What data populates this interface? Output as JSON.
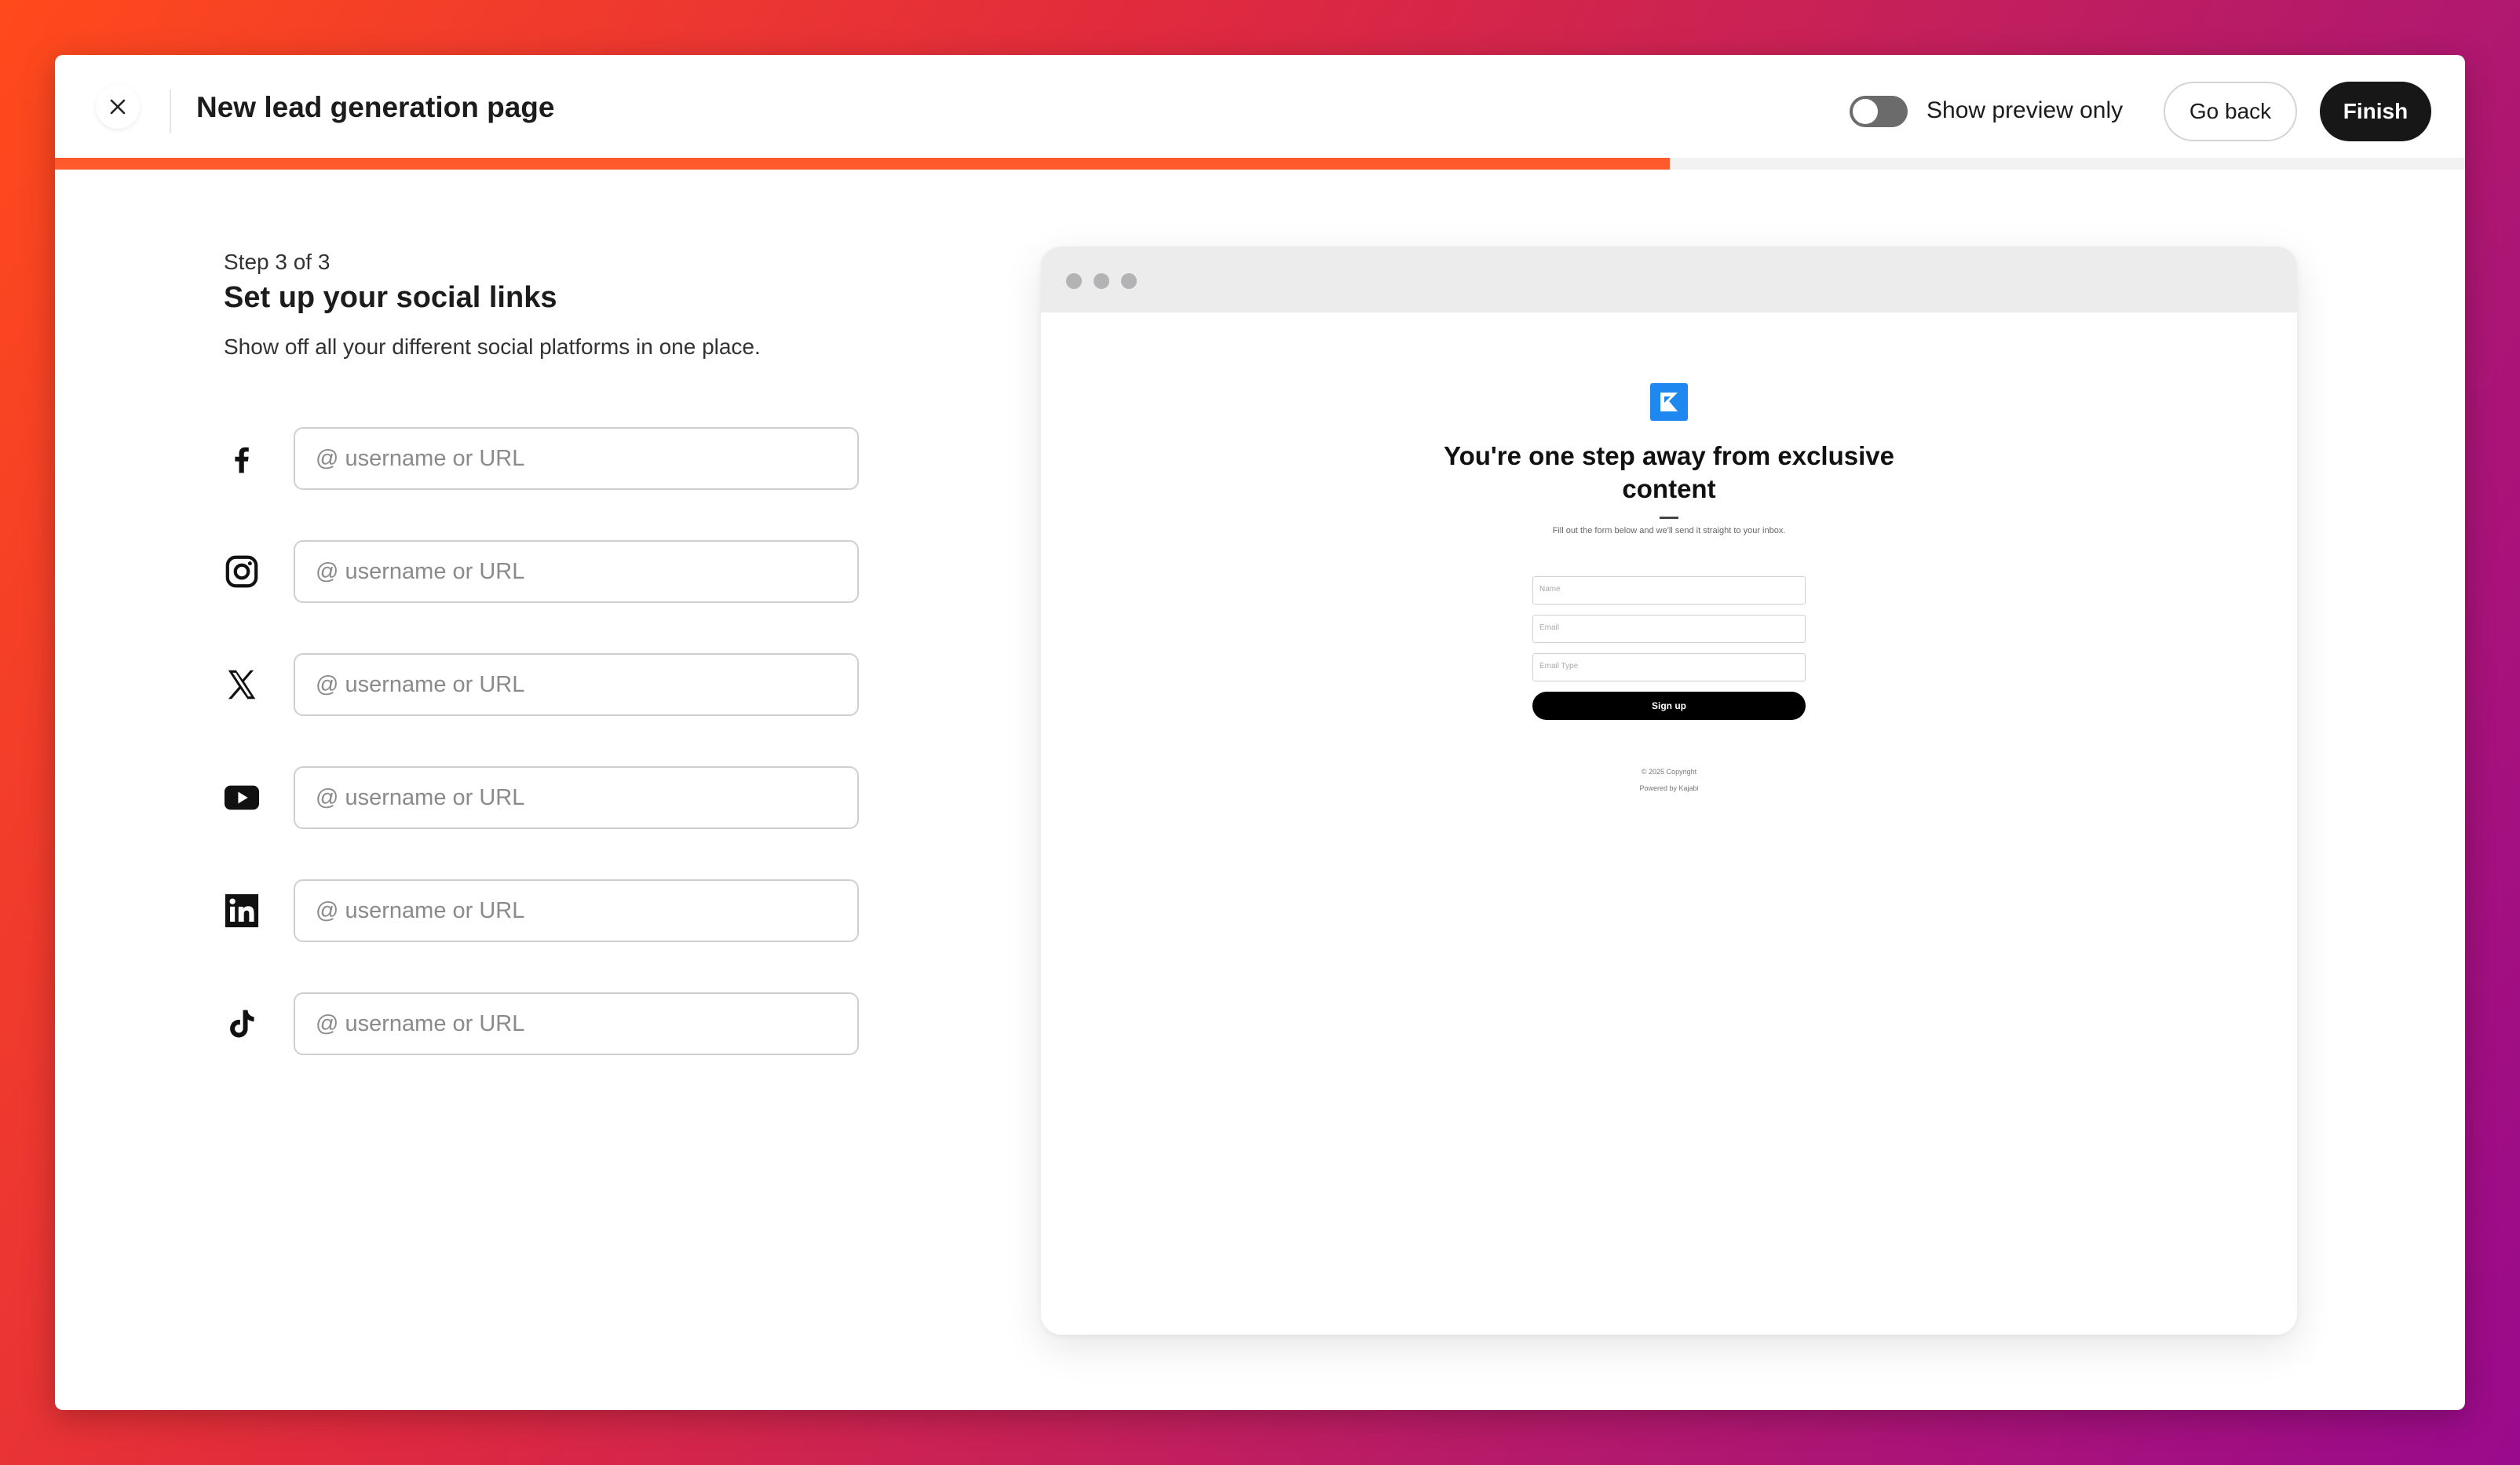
{
  "header": {
    "title": "New lead generation page",
    "toggle_label": "Show preview only",
    "toggle_on": false,
    "go_back_label": "Go back",
    "finish_label": "Finish",
    "progress_fraction": 0.67
  },
  "step": {
    "label": "Step 3 of 3",
    "title": "Set up your social links",
    "description": "Show off all your different social platforms in one place."
  },
  "social_links": [
    {
      "platform": "facebook",
      "icon": "facebook-icon",
      "placeholder": "@ username or URL",
      "value": ""
    },
    {
      "platform": "instagram",
      "icon": "instagram-icon",
      "placeholder": "@ username or URL",
      "value": ""
    },
    {
      "platform": "x",
      "icon": "x-icon",
      "placeholder": "@ username or URL",
      "value": ""
    },
    {
      "platform": "youtube",
      "icon": "youtube-icon",
      "placeholder": "@ username or URL",
      "value": ""
    },
    {
      "platform": "linkedin",
      "icon": "linkedin-icon",
      "placeholder": "@ username or URL",
      "value": ""
    },
    {
      "platform": "tiktok",
      "icon": "tiktok-icon",
      "placeholder": "@ username or URL",
      "value": ""
    }
  ],
  "preview": {
    "headline": "You're one step away from exclusive content",
    "subtext": "Fill out the form below and we'll send it straight to your inbox.",
    "fields": {
      "name_placeholder": "Name",
      "email_placeholder": "Email",
      "email_type_placeholder": "Email Type"
    },
    "signup_label": "Sign up",
    "copyright": "© 2025 Copyright",
    "powered_by": "Powered by Kajabi"
  },
  "colors": {
    "accent": "#ff5a2e",
    "primary_button": "#171717",
    "logo_blue": "#1e88f0"
  }
}
